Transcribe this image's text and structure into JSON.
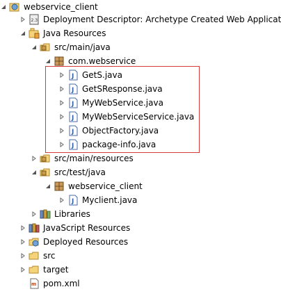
{
  "tree": {
    "project": "webservice_client",
    "deployment_descriptor": "Deployment Descriptor: Archetype Created Web Applicatio",
    "java_resources": "Java Resources",
    "src_main_java": "src/main/java",
    "pkg_com_webservice": "com.webservice",
    "files_main": [
      "GetS.java",
      "GetSResponse.java",
      "MyWebService.java",
      "MyWebServiceService.java",
      "ObjectFactory.java",
      "package-info.java"
    ],
    "src_main_resources": "src/main/resources",
    "src_test_java": "src/test/java",
    "pkg_webservice_client": "webservice_client",
    "file_test": "Myclient.java",
    "libraries": "Libraries",
    "javascript_resources": "JavaScript Resources",
    "deployed_resources": "Deployed Resources",
    "src": "src",
    "target": "target",
    "pom": "pom.xml"
  },
  "icons": {
    "project": "web-project-icon",
    "deployment": "deployment-descriptor-icon",
    "java_resources": "java-resources-icon",
    "source_folder": "source-folder-icon",
    "package": "package-icon",
    "java_file": "java-file-icon",
    "libraries": "libraries-icon",
    "js_resources": "javascript-resources-icon",
    "deployed": "deployed-resources-icon",
    "folder": "folder-icon",
    "xml_file": "xml-file-icon"
  },
  "colors": {
    "highlight_border": "#d63a3a"
  }
}
